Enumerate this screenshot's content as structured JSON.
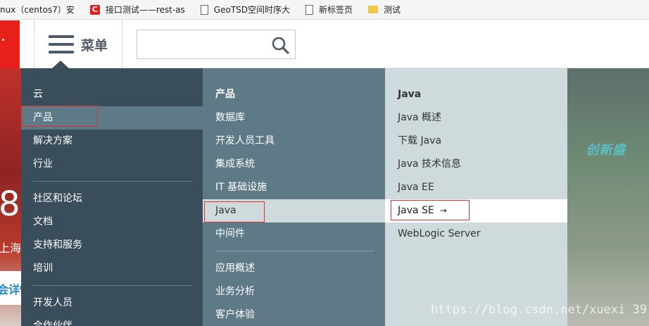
{
  "bookmarks": [
    {
      "label": "nux（centos7）安",
      "icon": "none"
    },
    {
      "label": "接口测试——rest-as",
      "icon": "red-c-icon"
    },
    {
      "label": "GeoTSD空间时序大",
      "icon": "page-icon"
    },
    {
      "label": "新标签页",
      "icon": "page-icon"
    },
    {
      "label": "测试",
      "icon": "folder-icon"
    }
  ],
  "header": {
    "menu_label": "菜单",
    "search_placeholder": ""
  },
  "background": {
    "num": "8",
    "city": "上海",
    "button": "会详情",
    "right_text": "创新盛"
  },
  "level1": {
    "group1": [
      "云",
      "产品",
      "解决方案",
      "行业"
    ],
    "group2": [
      "社区和论坛",
      "文档",
      "支持和服务",
      "培训"
    ],
    "group3": [
      "开发人员",
      "合作伙伴"
    ],
    "active": "产品"
  },
  "level2": {
    "heading": "产品",
    "items": [
      "数据库",
      "开发人员工具",
      "集成系统",
      "IT 基础设施",
      "Java",
      "中间件"
    ],
    "items2": [
      "应用概述",
      "业务分析",
      "客户体验"
    ],
    "active": "Java"
  },
  "level3": {
    "heading": "Java",
    "items": [
      "Java 概述",
      "下载 Java",
      "Java 技术信息",
      "Java EE",
      "Java SE",
      "WebLogic Server"
    ],
    "active": "Java SE",
    "arrow": "→"
  },
  "watermark": "https://blog.csdn.net/xuexi 39",
  "colors": {
    "panel1": "#3a4d5a",
    "panel2": "#5f7a87",
    "panel3": "#cfdadc",
    "highlight": "#e03030",
    "brand_red": "#e8201c"
  }
}
